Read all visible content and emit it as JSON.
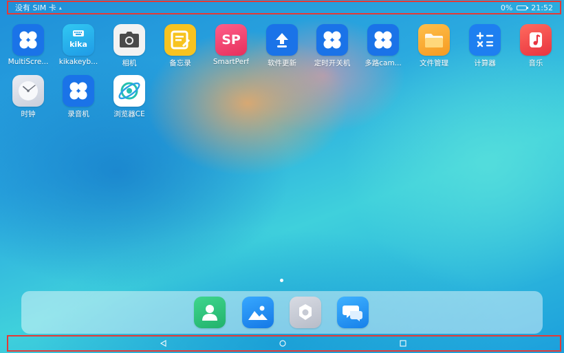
{
  "status_bar": {
    "carrier": "没有 SIM 卡",
    "battery": "0%",
    "time": "21:52"
  },
  "apps": [
    {
      "label": "MultiScre...",
      "icon": "four-petal-icon"
    },
    {
      "label": "kikakeyb...",
      "icon": "keyboard-icon",
      "badge": "kika"
    },
    {
      "label": "相机",
      "icon": "camera-icon"
    },
    {
      "label": "备忘录",
      "icon": "notepad-icon"
    },
    {
      "label": "SmartPerf",
      "icon": "smartperf-icon",
      "badge": "SP"
    },
    {
      "label": "软件更新",
      "icon": "upload-arrow-icon"
    },
    {
      "label": "定时开关机",
      "icon": "four-petal-icon"
    },
    {
      "label": "多路cam...",
      "icon": "four-petal-icon"
    },
    {
      "label": "文件管理",
      "icon": "folder-icon"
    },
    {
      "label": "计算器",
      "icon": "calculator-icon",
      "badge": "+−×="
    },
    {
      "label": "音乐",
      "icon": "music-note-icon"
    },
    {
      "label": "时钟",
      "icon": "clock-icon"
    },
    {
      "label": "录音机",
      "icon": "four-petal-icon"
    },
    {
      "label": "浏览器CE",
      "icon": "browser-planet-icon"
    }
  ],
  "dock": [
    {
      "icon": "contacts-icon"
    },
    {
      "icon": "gallery-icon"
    },
    {
      "icon": "settings-icon"
    },
    {
      "icon": "messages-icon"
    }
  ],
  "colors": {
    "highlight_border": "#e53935",
    "app_blue": "#1a73e8",
    "camera_bg": "#f2f2f2",
    "notepad_bg": "#f7c320",
    "smartperf_bg": "#ef3d6c",
    "folder_bg": "#f7a531",
    "music_bg": "#ef4b4b",
    "contacts_bg": "#2fc27a"
  }
}
